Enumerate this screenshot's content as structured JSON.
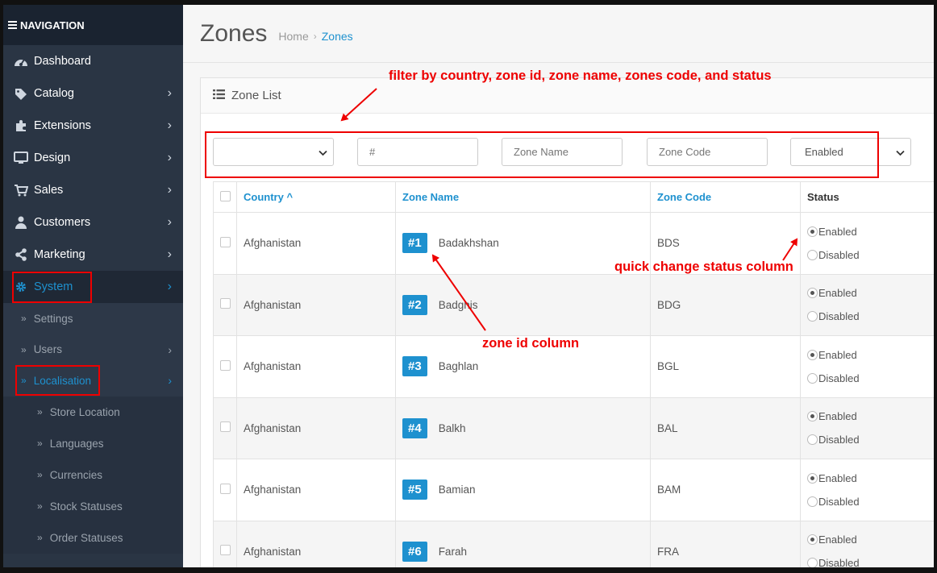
{
  "sidebar": {
    "header": "NAVIGATION",
    "menu": [
      {
        "label": "Dashboard",
        "icon": "dashboard-icon",
        "chevron": false
      },
      {
        "label": "Catalog",
        "icon": "tag-icon",
        "chevron": true
      },
      {
        "label": "Extensions",
        "icon": "puzzle-icon",
        "chevron": true
      },
      {
        "label": "Design",
        "icon": "monitor-icon",
        "chevron": true
      },
      {
        "label": "Sales",
        "icon": "cart-icon",
        "chevron": true
      },
      {
        "label": "Customers",
        "icon": "user-icon",
        "chevron": true
      },
      {
        "label": "Marketing",
        "icon": "share-icon",
        "chevron": true
      },
      {
        "label": "System",
        "icon": "gear-icon",
        "chevron": true
      }
    ],
    "system_sub": [
      {
        "label": "Settings",
        "chevron": false
      },
      {
        "label": "Users",
        "chevron": true
      },
      {
        "label": "Localisation",
        "chevron": true
      }
    ],
    "localisation_sub": [
      {
        "label": "Store Location"
      },
      {
        "label": "Languages"
      },
      {
        "label": "Currencies"
      },
      {
        "label": "Stock Statuses"
      },
      {
        "label": "Order Statuses"
      }
    ]
  },
  "header": {
    "title": "Zones",
    "breadcrumb_home": "Home",
    "breadcrumb_sep": "›",
    "breadcrumb_current": "Zones"
  },
  "panel": {
    "title": "Zone List"
  },
  "filters": {
    "country_value": "",
    "id_placeholder": "#",
    "name_placeholder": "Zone Name",
    "code_placeholder": "Zone Code",
    "status_value": "Enabled"
  },
  "table": {
    "columns": {
      "country": "Country",
      "country_sort": "^",
      "zone_name": "Zone Name",
      "zone_code": "Zone Code",
      "status": "Status"
    },
    "status_labels": {
      "enabled": "Enabled",
      "disabled": "Disabled"
    },
    "rows": [
      {
        "country": "Afghanistan",
        "id": "#1",
        "name": "Badakhshan",
        "code": "BDS",
        "status": "enabled"
      },
      {
        "country": "Afghanistan",
        "id": "#2",
        "name": "Badghis",
        "code": "BDG",
        "status": "enabled"
      },
      {
        "country": "Afghanistan",
        "id": "#3",
        "name": "Baghlan",
        "code": "BGL",
        "status": "enabled"
      },
      {
        "country": "Afghanistan",
        "id": "#4",
        "name": "Balkh",
        "code": "BAL",
        "status": "enabled"
      },
      {
        "country": "Afghanistan",
        "id": "#5",
        "name": "Bamian",
        "code": "BAM",
        "status": "enabled"
      },
      {
        "country": "Afghanistan",
        "id": "#6",
        "name": "Farah",
        "code": "FRA",
        "status": "enabled"
      }
    ]
  },
  "annotations": {
    "filter_note": "filter by country, zone id, zone name, zones code, and status",
    "status_note": "quick change status column",
    "id_note": "zone id column"
  },
  "colors": {
    "accent": "#1e91cf",
    "sidebar_bg": "#2a3544",
    "annotation": "#e00000"
  }
}
